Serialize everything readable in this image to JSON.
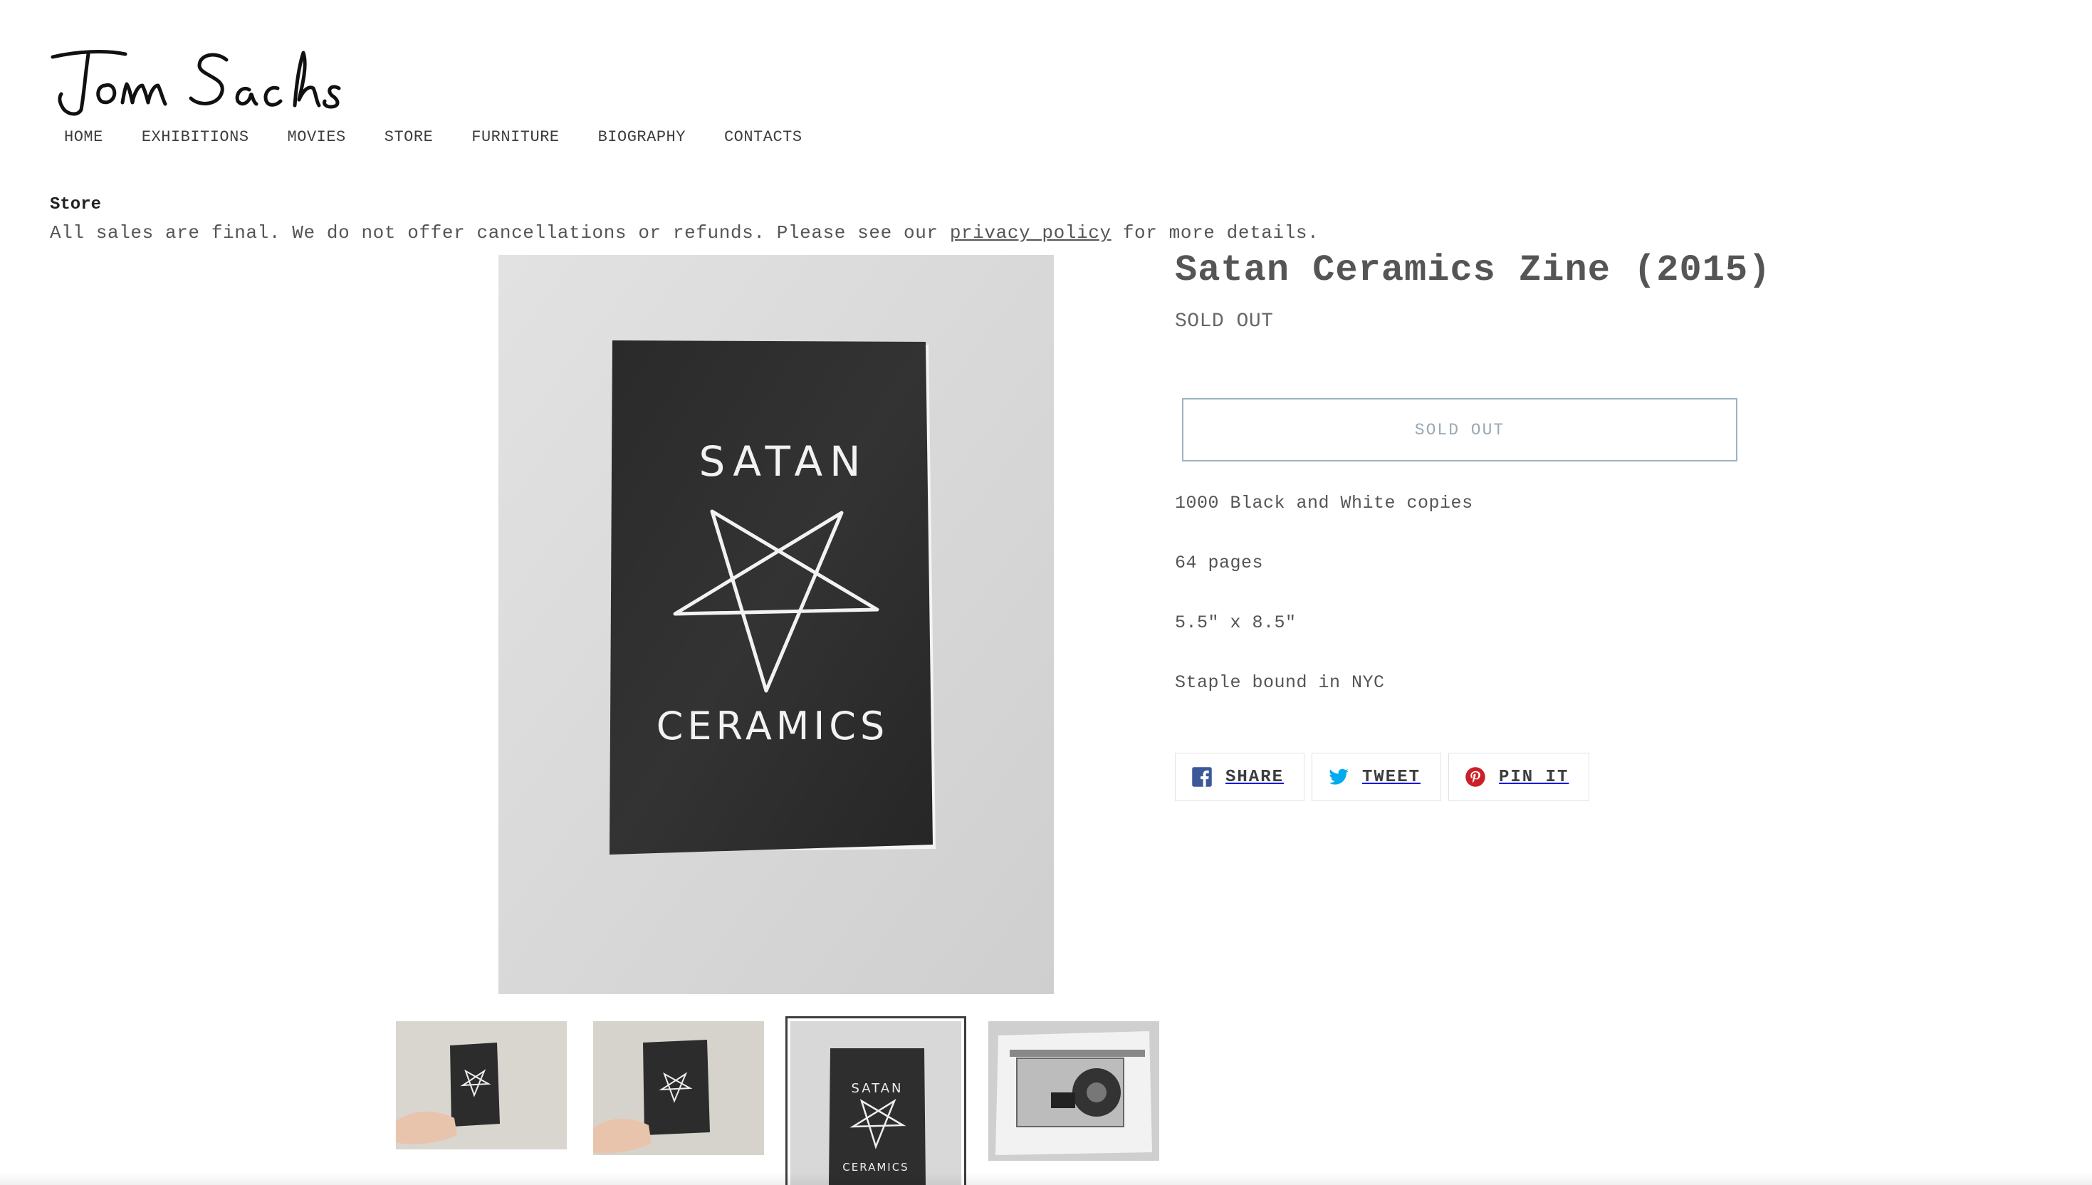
{
  "brand": {
    "logo_text": "Tom Sachs"
  },
  "nav": {
    "items": [
      {
        "label": "HOME"
      },
      {
        "label": "EXHIBITIONS"
      },
      {
        "label": "MOVIES"
      },
      {
        "label": "STORE"
      },
      {
        "label": "FURNITURE"
      },
      {
        "label": "BIOGRAPHY"
      },
      {
        "label": "CONTACTS"
      }
    ]
  },
  "store": {
    "title": "Store",
    "notice_before": "All sales are final. We do not offer cancellations or refunds. Please see our ",
    "notice_link": "privacy policy",
    "notice_after": " for more details."
  },
  "product": {
    "title": "Satan Ceramics Zine (2015)",
    "price_status": "SOLD OUT",
    "button_label": "SOLD OUT",
    "cover_text_top": "SATAN",
    "cover_text_bottom": "CERAMICS",
    "description": [
      "1000 Black and White copies",
      "64 pages",
      "5.5\" x 8.5\"",
      "Staple bound in NYC"
    ]
  },
  "share": {
    "facebook_label": "SHARE",
    "twitter_label": "TWEET",
    "pinterest_label": "PIN IT",
    "colors": {
      "facebook": "#3b5998",
      "twitter": "#00aced",
      "pinterest": "#cb2027"
    }
  },
  "thumbnails": {
    "count": 4,
    "active_index": 2
  }
}
